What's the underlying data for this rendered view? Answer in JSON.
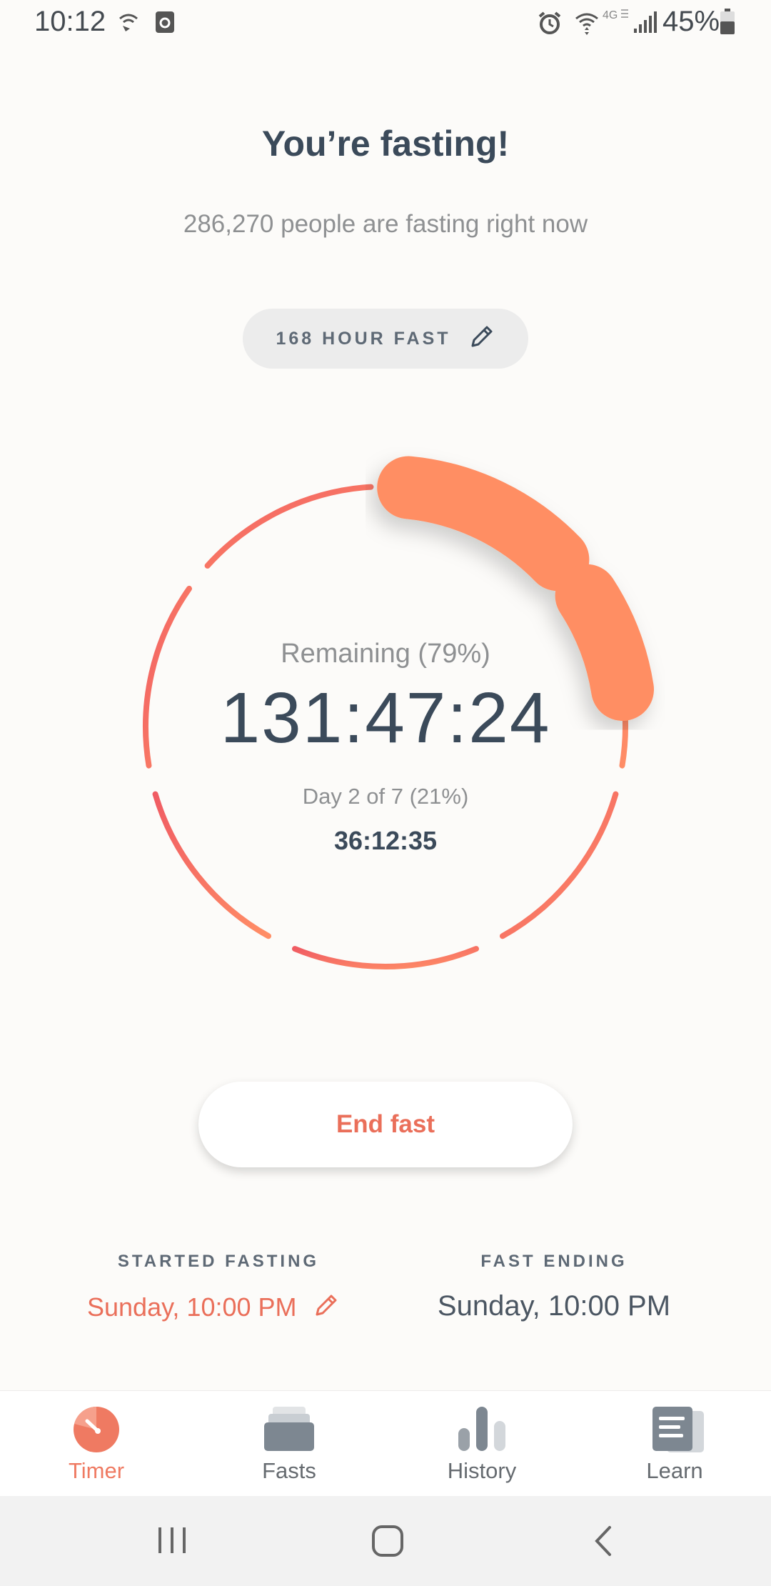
{
  "status_bar": {
    "time": "10:12",
    "battery": "45%",
    "icons": [
      "wifi-calling-icon",
      "screenshot-icon",
      "alarm-icon",
      "wifi-icon",
      "4g-icon",
      "signal-icon",
      "battery-icon"
    ]
  },
  "header": {
    "title": "You’re fasting!",
    "subtitle": "286,270 people are fasting right now"
  },
  "fast_type": {
    "label": "168 HOUR FAST",
    "icon": "pencil-icon"
  },
  "timer": {
    "remaining_label": "Remaining (79%)",
    "remaining_time": "131:47:24",
    "day_label": "Day 2 of 7 (21%)",
    "elapsed_time": "36:12:35",
    "progress_fraction": 0.21,
    "gradient_colors": [
      "#f05c63",
      "#ff8e66"
    ],
    "progress_color": "#ff8e63"
  },
  "actions": {
    "end_fast": "End fast"
  },
  "info": {
    "started_heading": "STARTED FASTING",
    "started_value": "Sunday, 10:00 PM",
    "ending_heading": "FAST ENDING",
    "ending_value": "Sunday, 10:00 PM"
  },
  "tabs": [
    {
      "label": "Timer",
      "icon": "timer-icon",
      "active": true
    },
    {
      "label": "Fasts",
      "icon": "fasts-icon",
      "active": false
    },
    {
      "label": "History",
      "icon": "history-icon",
      "active": false
    },
    {
      "label": "Learn",
      "icon": "learn-icon",
      "active": false
    }
  ],
  "colors": {
    "accent": "#ef7a62",
    "text_dark": "#3b4a5a",
    "background": "#fcfbf9"
  }
}
